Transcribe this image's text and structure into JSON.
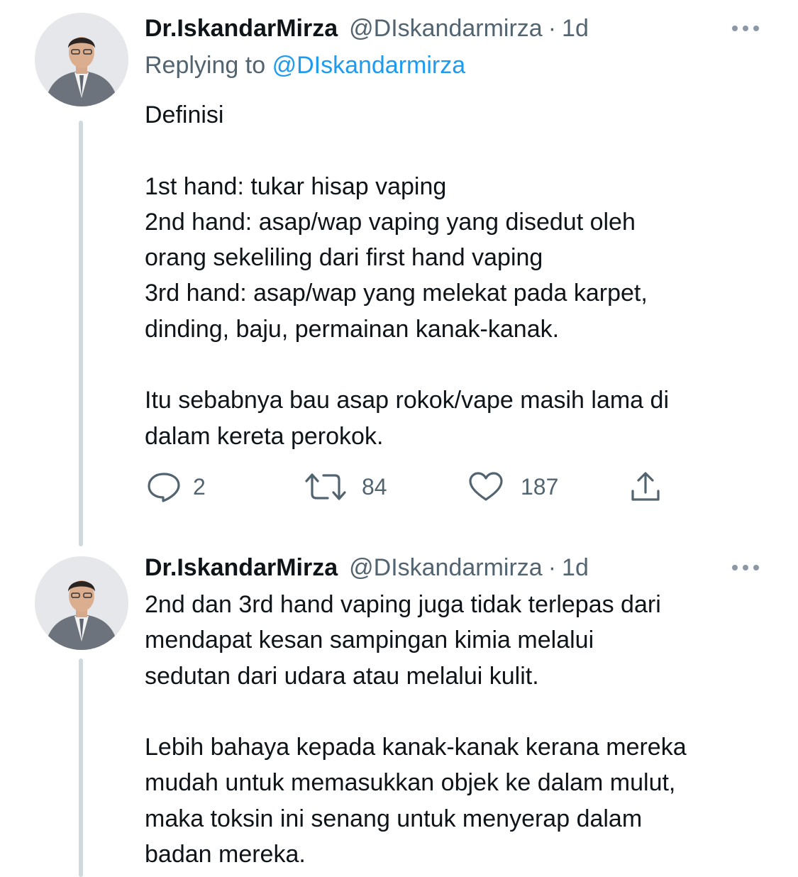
{
  "tweets": [
    {
      "display_name": "Dr.IskandarMirza",
      "handle": "@DIskandarmirza",
      "separator": "·",
      "time": "1d",
      "replying_prefix": "Replying to",
      "replying_to": "@DIskandarmirza",
      "lines": [
        "Definisi",
        "",
        "1st hand: tukar hisap vaping",
        "2nd hand: asap/wap vaping yang disedut oleh",
        "orang sekeliling dari first hand vaping",
        "3rd hand: asap/wap yang melekat pada karpet,",
        "dinding, baju, permainan kanak-kanak.",
        "",
        "Itu sebabnya bau asap rokok/vape masih lama di",
        "dalam kereta perokok."
      ],
      "actions": {
        "reply_count": "2",
        "retweet_count": "84",
        "like_count": "187"
      }
    },
    {
      "display_name": "Dr.IskandarMirza",
      "handle": "@DIskandarmirza",
      "separator": "·",
      "time": "1d",
      "lines": [
        "2nd dan 3rd hand vaping juga tidak terlepas dari",
        "mendapat kesan sampingan kimia melalui",
        "sedutan dari udara atau melalui kulit.",
        "",
        "Lebih bahaya kepada kanak-kanak kerana mereka",
        "mudah untuk memasukkan objek ke dalam mulut,",
        "maka toksin ini senang untuk menyerap dalam",
        "badan mereka."
      ]
    }
  ],
  "icons": {
    "more": "more-horizontal-icon",
    "reply": "speech-bubble-icon",
    "retweet": "retweet-arrows-icon",
    "like": "heart-icon",
    "share": "share-upload-icon"
  },
  "colors": {
    "text": "#0f1419",
    "secondary": "#536471",
    "link": "#1d9bf0",
    "thread_line": "#cfd9de",
    "background": "#ffffff"
  }
}
